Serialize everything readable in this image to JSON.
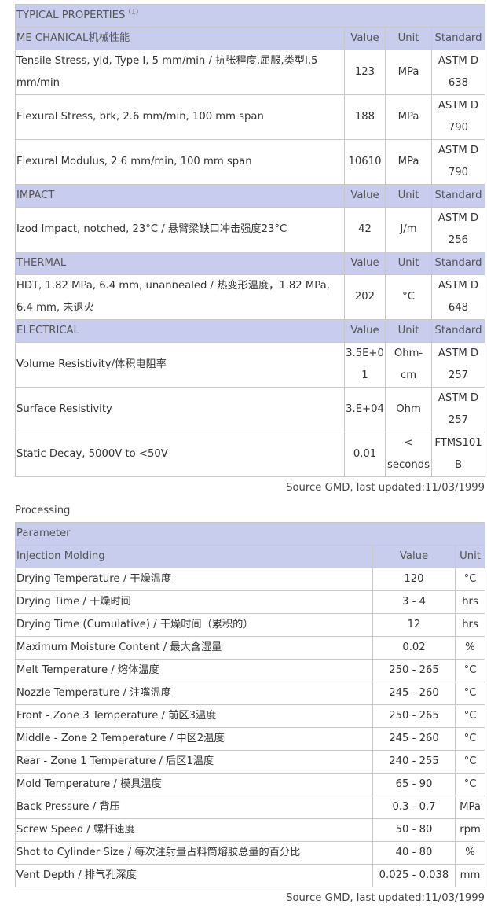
{
  "typical": {
    "title": "TYPICAL PROPERTIES",
    "title_sup": "(1)",
    "sections": [
      {
        "name": "ME CHANICAL机械性能",
        "header": {
          "value": "Value",
          "unit": "Unit",
          "standard": "Standard"
        },
        "rows": [
          {
            "property": "Tensile Stress, yld, Type I, 5 mm/min / 抗张程度,屈服,类型I,5 mm/min",
            "value": "123",
            "unit": "MPa",
            "standard": "ASTM D 638"
          },
          {
            "property": "Flexural Stress, brk, 2.6 mm/min, 100 mm span",
            "value": "188",
            "unit": "MPa",
            "standard": "ASTM D 790"
          },
          {
            "property": "Flexural Modulus, 2.6 mm/min, 100 mm span",
            "value": "10610",
            "unit": "MPa",
            "standard": "ASTM D 790"
          }
        ]
      },
      {
        "name": "IMPACT",
        "header": {
          "value": "Value",
          "unit": "Unit",
          "standard": "Standard"
        },
        "rows": [
          {
            "property": "Izod Impact, notched, 23°C / 悬臂梁缺口冲击强度23°C",
            "value": "42",
            "unit": "J/m",
            "standard": "ASTM D 256"
          }
        ]
      },
      {
        "name": "THERMAL",
        "header": {
          "value": "Value",
          "unit": "Unit",
          "standard": "Standard"
        },
        "rows": [
          {
            "property": "HDT, 1.82 MPa, 6.4 mm, unannealed / 热变形温度，1.82 MPa, 6.4 mm, 未退火",
            "value": "202",
            "unit": "°C",
            "standard": "ASTM D 648"
          }
        ]
      },
      {
        "name": "ELECTRICAL",
        "header": {
          "value": "Value",
          "unit": "Unit",
          "standard": "Standard"
        },
        "rows": [
          {
            "property": "Volume Resistivity/体积电阻率",
            "value": "3.5E+01",
            "unit": "Ohm-cm",
            "standard": "ASTM D 257"
          },
          {
            "property": "Surface Resistivity",
            "value": "3.E+04",
            "unit": "Ohm",
            "standard": "ASTM D 257"
          },
          {
            "property": "Static Decay, 5000V to <50V",
            "value": "0.01",
            "unit": "< seconds",
            "standard": "FTMS101B"
          }
        ]
      }
    ],
    "source": "Source GMD, last updated:11/03/1999"
  },
  "processing": {
    "title": "Processing",
    "parameter_label": "Parameter",
    "section_name": "Injection Molding",
    "header": {
      "value": "Value",
      "unit": "Unit"
    },
    "rows": [
      {
        "parameter": "Drying Temperature / 干燥温度",
        "value": "120",
        "unit": "°C"
      },
      {
        "parameter": "Drying Time / 干燥时间",
        "value": "3 - 4",
        "unit": "hrs"
      },
      {
        "parameter": "Drying Time (Cumulative) / 干燥时间（累积的）",
        "value": "12",
        "unit": "hrs"
      },
      {
        "parameter": "Maximum Moisture Content / 最大含湿量",
        "value": "0.02",
        "unit": "%"
      },
      {
        "parameter": "Melt Temperature / 熔体温度",
        "value": "250 - 265",
        "unit": "°C"
      },
      {
        "parameter": "Nozzle Temperature / 注嘴温度",
        "value": "245 - 260",
        "unit": "°C"
      },
      {
        "parameter": "Front - Zone 3 Temperature / 前区3温度",
        "value": "250 - 265",
        "unit": "°C"
      },
      {
        "parameter": "Middle - Zone 2 Temperature / 中区2温度",
        "value": "245 - 260",
        "unit": "°C"
      },
      {
        "parameter": "Rear - Zone 1 Temperature / 后区1温度",
        "value": "240 - 255",
        "unit": "°C"
      },
      {
        "parameter": "Mold Temperature / 模具温度",
        "value": "65 - 90",
        "unit": "°C"
      },
      {
        "parameter": "Back Pressure / 背压",
        "value": "0.3 - 0.7",
        "unit": "MPa"
      },
      {
        "parameter": "Screw Speed / 螺杆速度",
        "value": "50 - 80",
        "unit": "rpm"
      },
      {
        "parameter": "Shot to Cylinder Size / 每次注射量占料筒熔胶总量的百分比",
        "value": "40 - 80",
        "unit": "%"
      },
      {
        "parameter": "Vent Depth / 排气孔深度",
        "value": "0.025 - 0.038",
        "unit": "mm"
      }
    ],
    "source": "Source GMD, last updated:11/03/1999"
  },
  "colors": {
    "section_bg": "#c8cdee",
    "border": "#c8c8c8",
    "text": "#333333"
  }
}
